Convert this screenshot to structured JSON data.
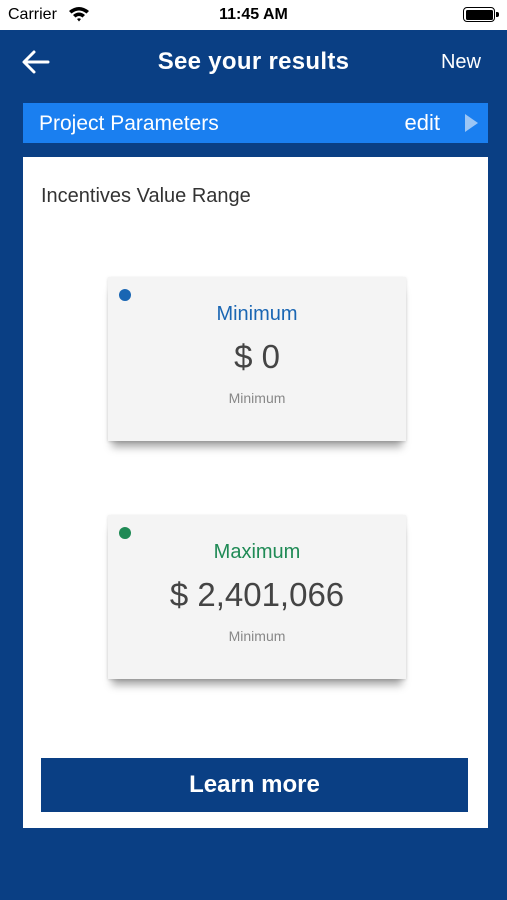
{
  "status": {
    "carrier": "Carrier",
    "time": "11:45 AM"
  },
  "nav": {
    "title": "See your results",
    "right_action": "New"
  },
  "params": {
    "title": "Project Parameters",
    "edit": "edit"
  },
  "content": {
    "heading": "Incentives Value Range",
    "cards": [
      {
        "label": "Minimum",
        "amount": "$ 0",
        "sublabel": "Minimum",
        "color": "#1a66b3"
      },
      {
        "label": "Maximum",
        "amount": "$ 2,401,066",
        "sublabel": "Minimum",
        "color": "#1f8a55"
      }
    ],
    "button": "Learn more"
  },
  "colors": {
    "background": "#0a3f84",
    "params_bar": "#1a7ff0",
    "min": "#1a66b3",
    "max": "#1f8a55"
  },
  "icons": [
    "wifi-icon",
    "battery-icon",
    "back-arrow-icon",
    "play-arrow-icon"
  ]
}
